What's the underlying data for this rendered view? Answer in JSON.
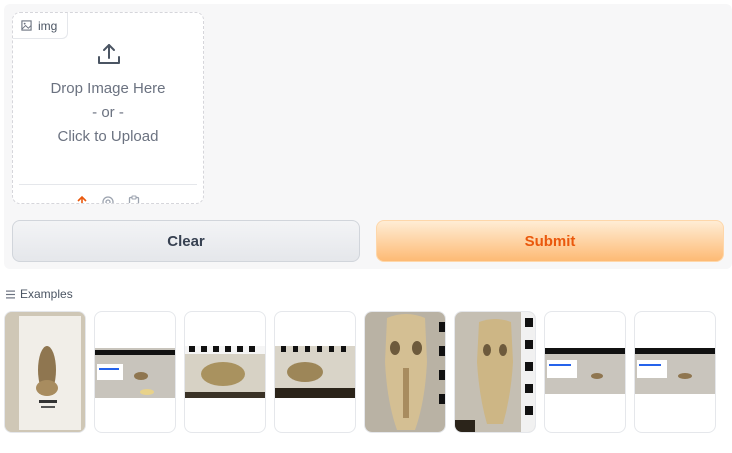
{
  "upload": {
    "tag_label": "img",
    "drop_text": "Drop Image Here",
    "or_text": "- or -",
    "click_text": "Click to Upload",
    "sources": [
      "upload-icon",
      "webcam-icon",
      "clipboard-icon"
    ]
  },
  "buttons": {
    "clear_label": "Clear",
    "submit_label": "Submit"
  },
  "examples": {
    "label": "Examples",
    "items": [
      {
        "kind": "skull-vertical-beige"
      },
      {
        "kind": "scale-bar-label"
      },
      {
        "kind": "skull-on-ruler"
      },
      {
        "kind": "skull-on-ruler-dark"
      },
      {
        "kind": "skull-closeup"
      },
      {
        "kind": "skull-closeup-ruler"
      },
      {
        "kind": "scale-bar-label-small"
      },
      {
        "kind": "scale-bar-label-small"
      }
    ]
  },
  "colors": {
    "accent": "#ea580c",
    "submit_bg": "#fdba74",
    "panel_bg": "#f7f7f8"
  }
}
